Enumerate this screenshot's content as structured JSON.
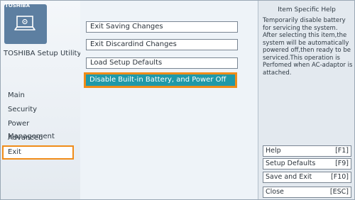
{
  "sidebar": {
    "brand": "TOSHIBA",
    "utility_title": "TOSHIBA Setup Utility",
    "logo_icon": "laptop-icon",
    "items": [
      {
        "label": "Main"
      },
      {
        "label": "Security"
      },
      {
        "label": "Power Management"
      },
      {
        "label": "Advanced"
      },
      {
        "label": "Exit"
      }
    ],
    "active_item": "Exit"
  },
  "main": {
    "options": [
      {
        "label": "Exit Saving Changes"
      },
      {
        "label": "Exit Discardind Changes"
      },
      {
        "label": "Load Setup Defaults"
      },
      {
        "label": "Disable Built-in Battery, and Power Off"
      }
    ],
    "selected_option": "Disable Built-in Battery, and Power Off"
  },
  "help": {
    "title": "Item Specific Help",
    "text": "Temporarily disable battery for servicing the system. After selecting this item,the system will be automatically powered off,then ready to be serviced.This operation is Perfomed when AC-adaptor is attached.",
    "keys": [
      {
        "label": "Help",
        "key": "[F1]"
      },
      {
        "label": "Setup Defaults",
        "key": "[F9]"
      },
      {
        "label": "Save and Exit",
        "key": "[F10]"
      },
      {
        "label": "Close",
        "key": "[ESC]"
      }
    ]
  },
  "colors": {
    "highlight_border": "#f08c19",
    "selected_bg": "#1f99a8",
    "logo_bg": "#5d7fa1"
  }
}
